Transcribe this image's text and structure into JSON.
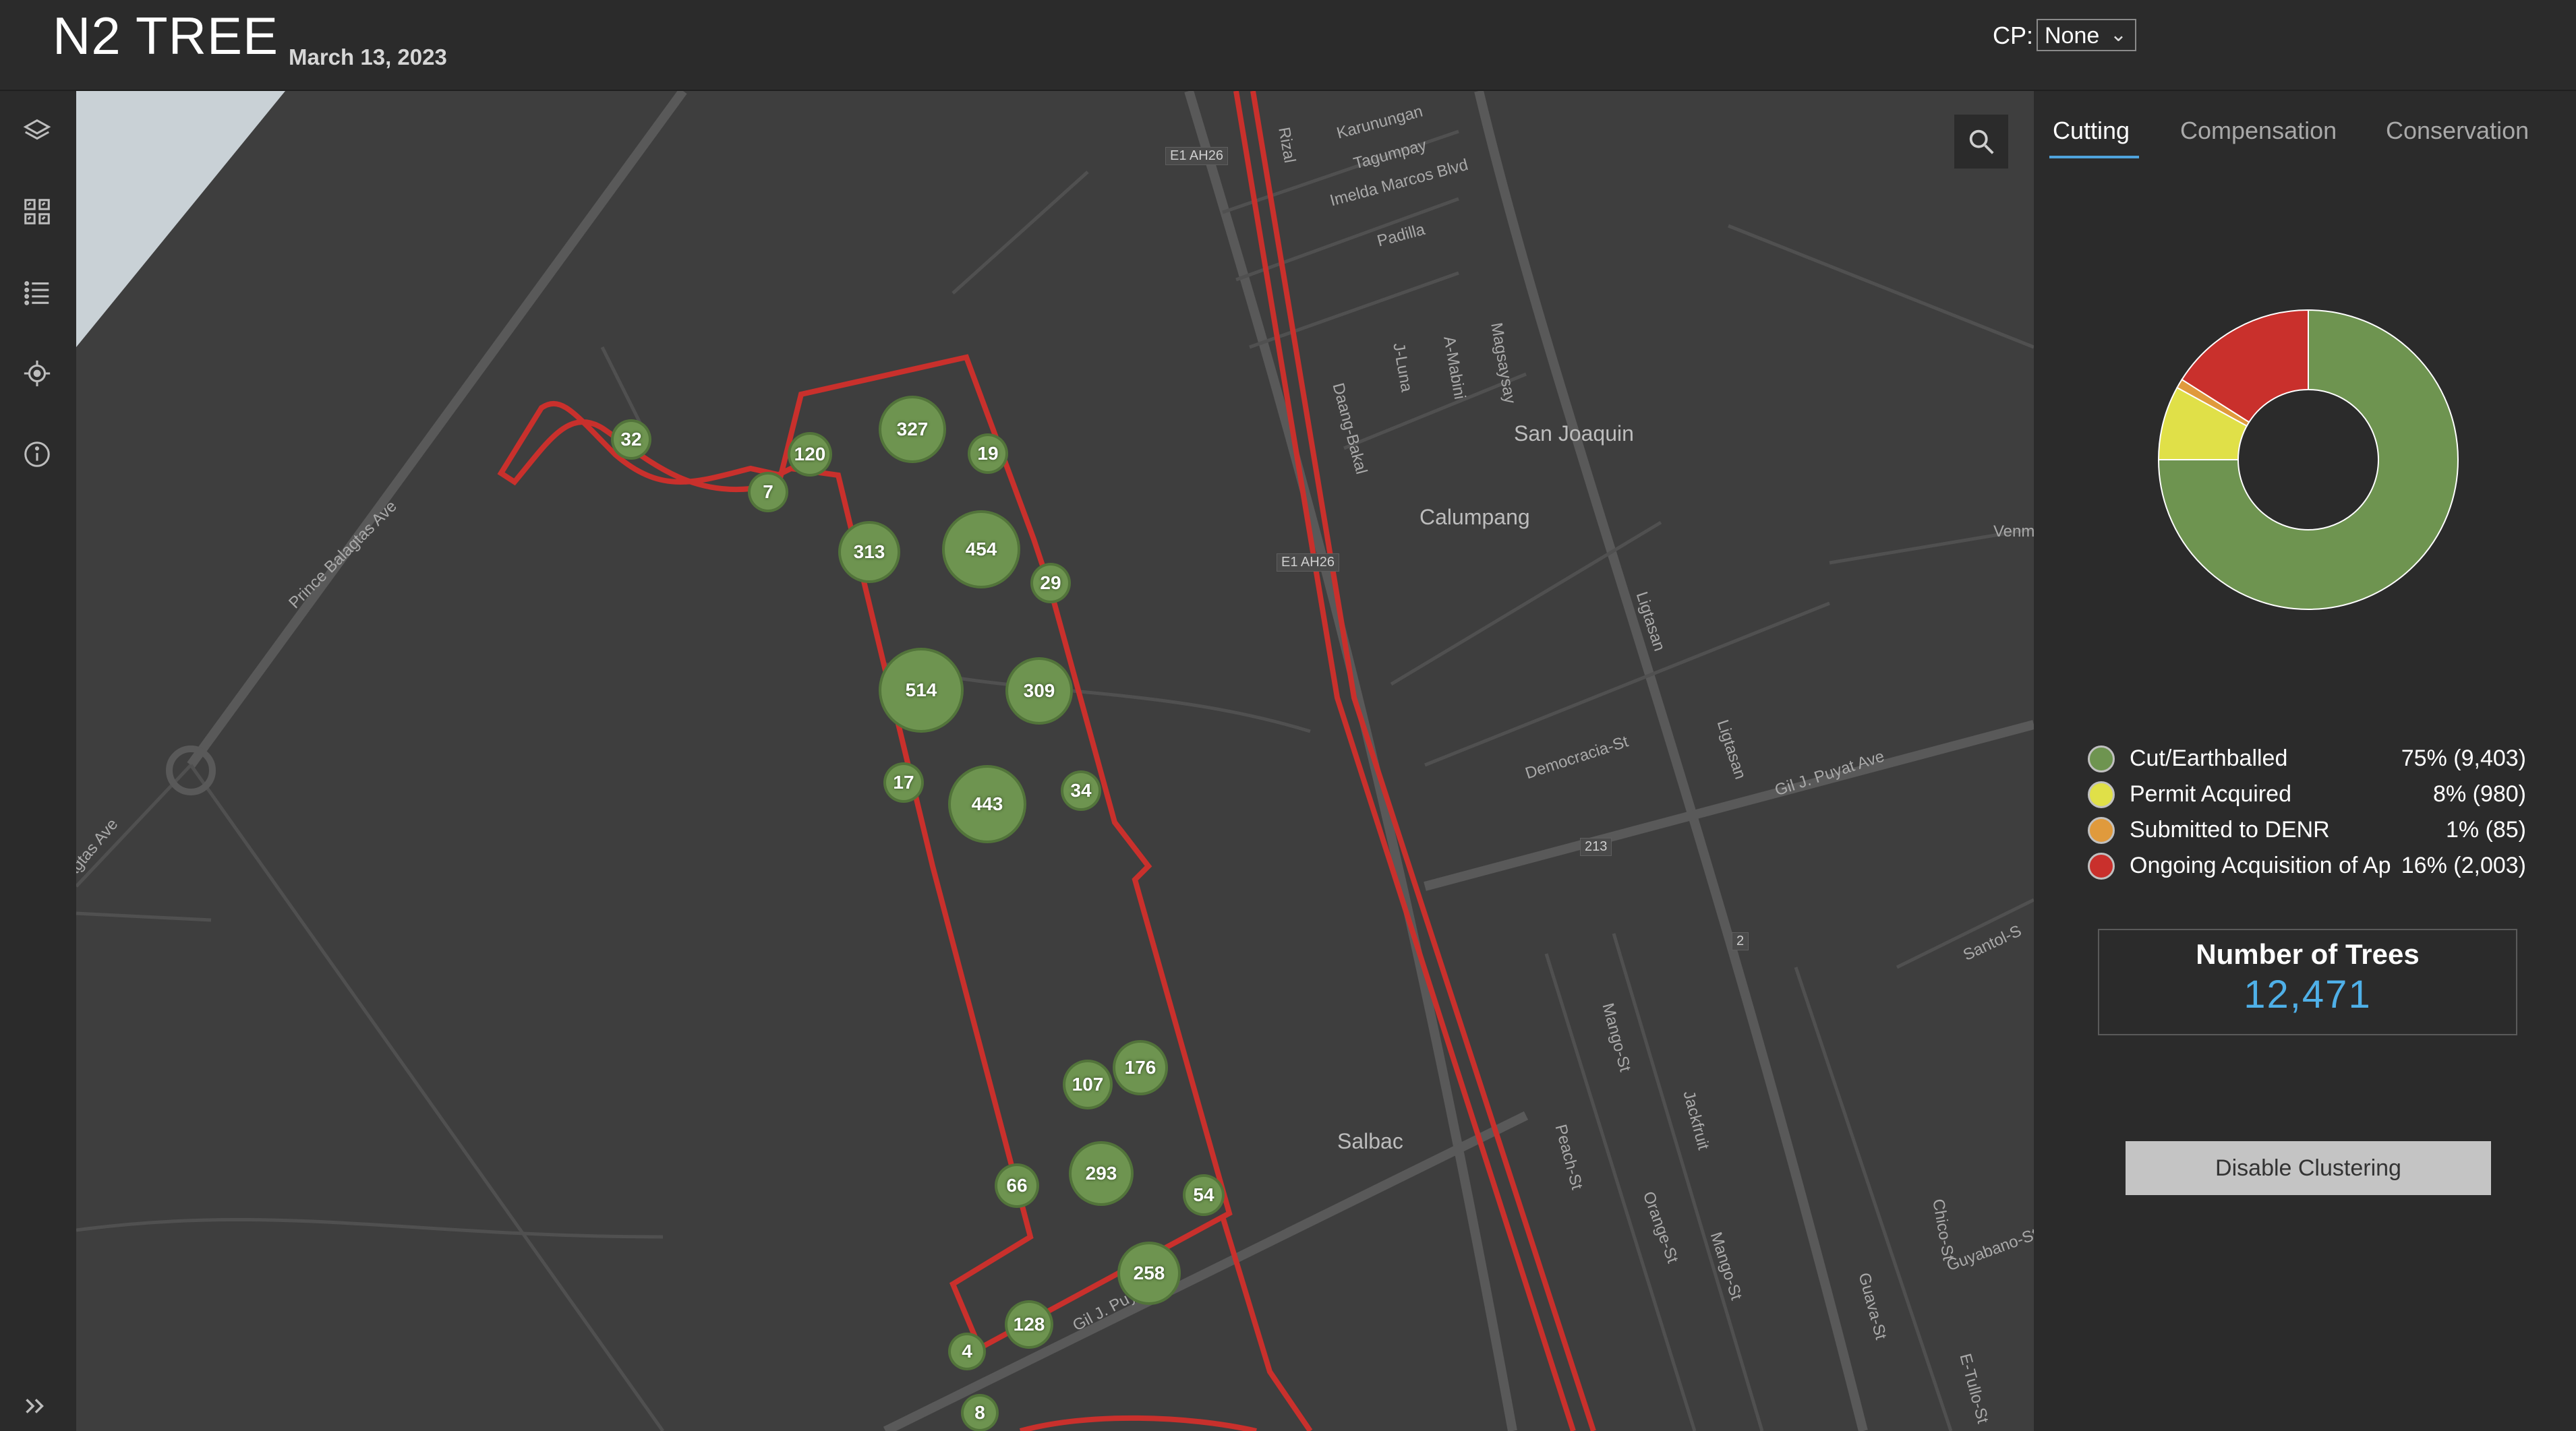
{
  "header": {
    "title": "N2 TREE",
    "date": "March 13, 2023",
    "cp_label": "CP:",
    "cp_value": "None"
  },
  "toolbar": {
    "icons": [
      "layers-icon",
      "basemap-gallery-icon",
      "legend-list-icon",
      "locate-icon",
      "info-icon"
    ],
    "expand_icon": "double-chevron-right-icon"
  },
  "map": {
    "clusters": [
      {
        "label": "32"
      },
      {
        "label": "120"
      },
      {
        "label": "7"
      },
      {
        "label": "327"
      },
      {
        "label": "19"
      },
      {
        "label": "313"
      },
      {
        "label": "454"
      },
      {
        "label": "29"
      },
      {
        "label": "514"
      },
      {
        "label": "309"
      },
      {
        "label": "17"
      },
      {
        "label": "443"
      },
      {
        "label": "34"
      },
      {
        "label": "176"
      },
      {
        "label": "107"
      },
      {
        "label": "66"
      },
      {
        "label": "293"
      },
      {
        "label": "54"
      },
      {
        "label": "258"
      },
      {
        "label": "128"
      },
      {
        "label": "4"
      },
      {
        "label": "8"
      }
    ],
    "places": {
      "san_joaquin": "San Joaquin",
      "calumpang": "Calumpang",
      "salbac": "Salbac"
    },
    "streets": {
      "prince_balagtas": "Prince Balagtas Ave",
      "balagtas": "agtas Ave",
      "karunungan": "Karunungan",
      "tagumpay": "Tagumpay",
      "imelda": "Imelda Marcos Blvd",
      "padilla": "Padilla",
      "rizal": "Rizal",
      "daang_bakal": "Daang-Bakal",
      "j_luna": "J-Luna",
      "a_mabini": "A-Mabini",
      "magsaysay": "Magsaysay",
      "ligtasan1": "Ligtasan",
      "ligtasan2": "Ligtasan",
      "democracia": "Democracia-St",
      "gil_puyat1": "Gil J. Puyat Ave",
      "gil_puyat2": "Gil J. Puyat Ave",
      "venma": "Venma",
      "mango": "Mango-St",
      "jackfruit": "Jackfruit",
      "peach": "Peach-St",
      "orange": "Orange-St",
      "mango2": "Mango-St",
      "santol": "Santol-S",
      "guava": "Guava-St",
      "chico": "Chico-St",
      "guyabano": "Guyabano-St",
      "e_tullo": "E-Tullo-St"
    },
    "shields": {
      "e1_ah26_top": "E1 AH26",
      "e1_ah26_mid": "E1 AH26",
      "r213": "213",
      "r2": "2"
    }
  },
  "panel": {
    "tabs": [
      {
        "label": "Cutting",
        "active": true
      },
      {
        "label": "Compensation",
        "active": false
      },
      {
        "label": "Conservation",
        "active": false
      }
    ],
    "legend": [
      {
        "label": "Cut/Earthballed",
        "value": "75% (9,403)",
        "color": "#6e9450"
      },
      {
        "label": "Permit Acquired",
        "value": "8% (980)",
        "color": "#e0e048"
      },
      {
        "label": "Submitted to DENR",
        "value": "1% (85)",
        "color": "#e09a3c"
      },
      {
        "label": "Ongoing Acquisition of Ap",
        "value": "16% (2,003)",
        "color": "#c9302c"
      }
    ],
    "donut_data": [
      {
        "name": "Cut/Earthballed",
        "percent": 75,
        "color": "#6e9450"
      },
      {
        "name": "Permit Acquired",
        "percent": 8,
        "color": "#e0e048"
      },
      {
        "name": "Submitted to DENR",
        "percent": 1,
        "color": "#e09a3c"
      },
      {
        "name": "Ongoing Acquisition of Ap",
        "percent": 16,
        "color": "#c9302c"
      }
    ],
    "stat": {
      "title": "Number of Trees",
      "value": "12,471"
    },
    "disable_button": "Disable Clustering"
  }
}
